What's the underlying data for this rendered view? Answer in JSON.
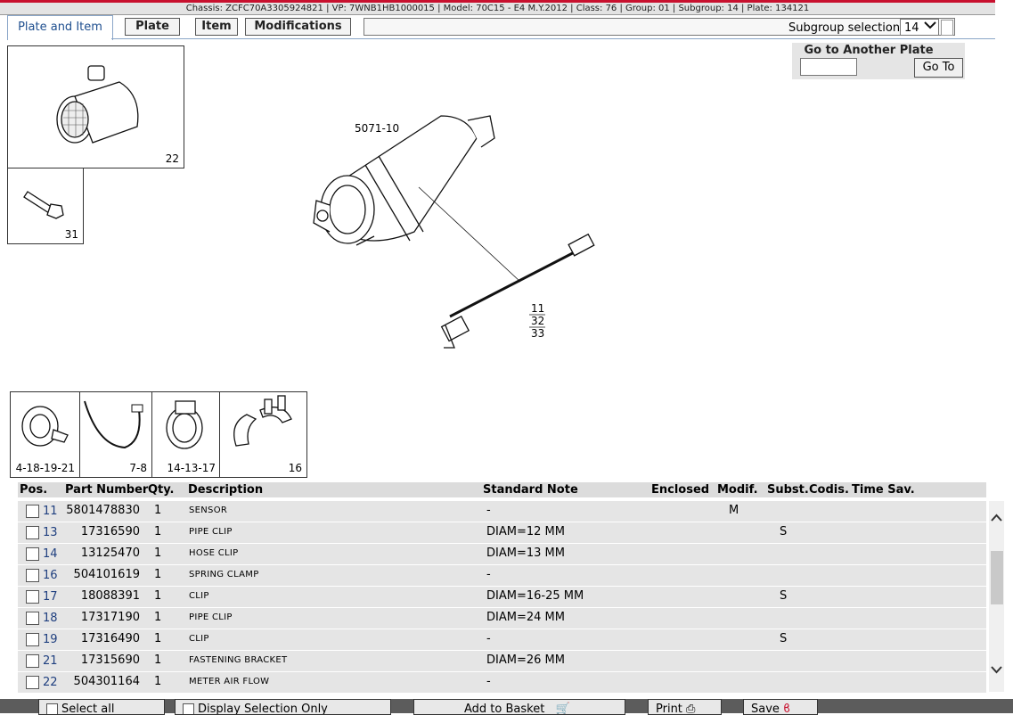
{
  "header": {
    "info": "Chassis: ZCFC70A3305924821 | VP: 7WNB1HB1000015 | Model: 70C15 - E4 M.Y.2012 | Class: 76 | Group: 01 | Subgroup: 14 | Plate: 134121"
  },
  "tabs": {
    "active": "Plate and Item",
    "buttons": [
      "Plate",
      "Item",
      "Modifications"
    ]
  },
  "subgroup": {
    "label": "Subgroup selection",
    "value": "14"
  },
  "goto": {
    "title": "Go to Another Plate",
    "input_value": "",
    "button": "Go To"
  },
  "thumbnails": {
    "top": [
      "22",
      "31"
    ],
    "bottom": [
      "4-18-19-21",
      "7-8",
      "14-13-17",
      "16"
    ]
  },
  "diagram": {
    "main_label": "5071-10",
    "sensor_refs": [
      "11",
      "32",
      "33"
    ]
  },
  "table": {
    "columns": [
      "Pos.",
      "Part Number",
      "Qty.",
      "Description",
      "Standard Note",
      "Enclosed",
      "Modif.",
      "Subst.",
      "Codis.",
      "Time Sav."
    ],
    "rows": [
      {
        "pos": "11",
        "part": "5801478830",
        "qty": "1",
        "desc": "SENSOR",
        "note": "-",
        "modif": "M",
        "subst": ""
      },
      {
        "pos": "13",
        "part": "17316590",
        "qty": "1",
        "desc": "PIPE CLIP",
        "note": "DIAM=12 MM",
        "modif": "",
        "subst": "S"
      },
      {
        "pos": "14",
        "part": "13125470",
        "qty": "1",
        "desc": "HOSE CLIP",
        "note": "DIAM=13 MM",
        "modif": "",
        "subst": ""
      },
      {
        "pos": "16",
        "part": "504101619",
        "qty": "1",
        "desc": "SPRING CLAMP",
        "note": "-",
        "modif": "",
        "subst": ""
      },
      {
        "pos": "17",
        "part": "18088391",
        "qty": "1",
        "desc": "CLIP",
        "note": "DIAM=16-25 MM",
        "modif": "",
        "subst": "S"
      },
      {
        "pos": "18",
        "part": "17317190",
        "qty": "1",
        "desc": "PIPE CLIP",
        "note": "DIAM=24 MM",
        "modif": "",
        "subst": ""
      },
      {
        "pos": "19",
        "part": "17316490",
        "qty": "1",
        "desc": "CLIP",
        "note": "-",
        "modif": "",
        "subst": "S"
      },
      {
        "pos": "21",
        "part": "17315690",
        "qty": "1",
        "desc": "FASTENING BRACKET",
        "note": "DIAM=26 MM",
        "modif": "",
        "subst": ""
      },
      {
        "pos": "22",
        "part": "504301164",
        "qty": "1",
        "desc": "METER AIR FLOW",
        "note": "-",
        "modif": "",
        "subst": ""
      }
    ]
  },
  "footer": {
    "select_all": "Select all",
    "display_selection": "Display Selection Only",
    "add_to_basket": "Add to Basket",
    "print": "Print",
    "save": "Save"
  }
}
